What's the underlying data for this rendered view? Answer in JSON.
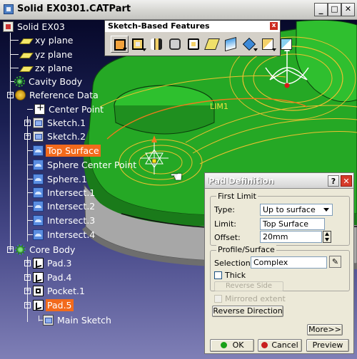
{
  "window": {
    "title": "Solid EX0301.CATPart",
    "controls": {
      "minimize": "_",
      "maximize": "□",
      "close": "✕"
    }
  },
  "tree": {
    "root": {
      "label": "Solid EX03",
      "icon": "part-icon"
    },
    "planes": [
      {
        "label": "xy plane",
        "icon": "plane-icon"
      },
      {
        "label": "yz plane",
        "icon": "plane-icon"
      },
      {
        "label": "zx plane",
        "icon": "plane-icon"
      }
    ],
    "cavity_body": {
      "label": "Cavity Body",
      "icon": "body-gear-icon"
    },
    "reference_data": {
      "label": "Reference Data",
      "icon": "reference-icon",
      "children": [
        {
          "label": "Center Point",
          "icon": "point-icon",
          "selected": false
        },
        {
          "label": "Sketch.1",
          "icon": "sketch-icon",
          "selected": false
        },
        {
          "label": "Sketch.2",
          "icon": "sketch-icon",
          "selected": false
        },
        {
          "label": "Top Surface",
          "icon": "surface-icon",
          "selected": true
        },
        {
          "label": "Sphere Center Point",
          "icon": "surface-icon",
          "selected": false
        },
        {
          "label": "Sphere.1",
          "icon": "surface-icon",
          "selected": false
        },
        {
          "label": "Intersect.1",
          "icon": "surface-icon",
          "selected": false
        },
        {
          "label": "Intersect.2",
          "icon": "surface-icon",
          "selected": false
        },
        {
          "label": "Intersect.3",
          "icon": "surface-icon",
          "selected": false
        },
        {
          "label": "Intersect.4",
          "icon": "surface-icon",
          "selected": false
        }
      ]
    },
    "core_body": {
      "label": "Core Body",
      "icon": "body-gear-icon",
      "children": [
        {
          "label": "Pad.3",
          "icon": "pad-icon",
          "selected": false
        },
        {
          "label": "Pad.4",
          "icon": "pad-icon",
          "selected": false
        },
        {
          "label": "Pocket.1",
          "icon": "pocket-icon",
          "selected": false
        },
        {
          "label": "Pad.5",
          "icon": "pad-icon",
          "selected": true
        }
      ],
      "sub": {
        "label": "Main Sketch",
        "icon": "main-sketch-icon"
      }
    }
  },
  "toolbar": {
    "title": "Sketch-Based Features",
    "close": "x",
    "icons": [
      {
        "name": "pad-tool-icon",
        "has_dropdown": true,
        "pressed": true
      },
      {
        "name": "pocket-tool-icon",
        "has_dropdown": true,
        "pressed": false
      },
      {
        "name": "shaft-tool-icon",
        "has_dropdown": false,
        "pressed": false
      },
      {
        "name": "groove-tool-icon",
        "has_dropdown": false,
        "pressed": false
      },
      {
        "name": "hole-tool-icon",
        "has_dropdown": false,
        "pressed": false
      },
      {
        "name": "rib-tool-icon",
        "has_dropdown": false,
        "pressed": false
      },
      {
        "name": "slot-tool-icon",
        "has_dropdown": false,
        "pressed": false
      },
      {
        "name": "stiffener-tool-icon",
        "has_dropdown": true,
        "pressed": false
      },
      {
        "name": "loft-tool-icon",
        "has_dropdown": true,
        "pressed": false
      },
      {
        "name": "remove-loft-tool-icon",
        "has_dropdown": false,
        "pressed": false
      }
    ]
  },
  "viewport": {
    "label_lim": "LIM1"
  },
  "dialog": {
    "title": "Pad Definition",
    "help": "?",
    "close": "✕",
    "first_limit": {
      "title": "First Limit",
      "type_label": "Type:",
      "type_value": "Up to surface",
      "limit_label": "Limit:",
      "limit_value": "Top Surface",
      "offset_label": "Offset:",
      "offset_value": "20mm"
    },
    "profile": {
      "title": "Profile/Surface",
      "selection_label": "Selection:",
      "selection_value": "Complex",
      "thick_label": "Thick",
      "reverse_side_label": "Reverse Side"
    },
    "mirrored_label": "Mirrored extent",
    "reverse_direction_label": "Reverse Direction",
    "more_label": "More>>",
    "ok_label": "OK",
    "cancel_label": "Cancel",
    "preview_label": "Preview"
  },
  "colors": {
    "selection": "#f26a1c",
    "part_green": "#1fae1f",
    "ok_dot": "#19a019",
    "cancel_dot": "#c81e1e"
  }
}
